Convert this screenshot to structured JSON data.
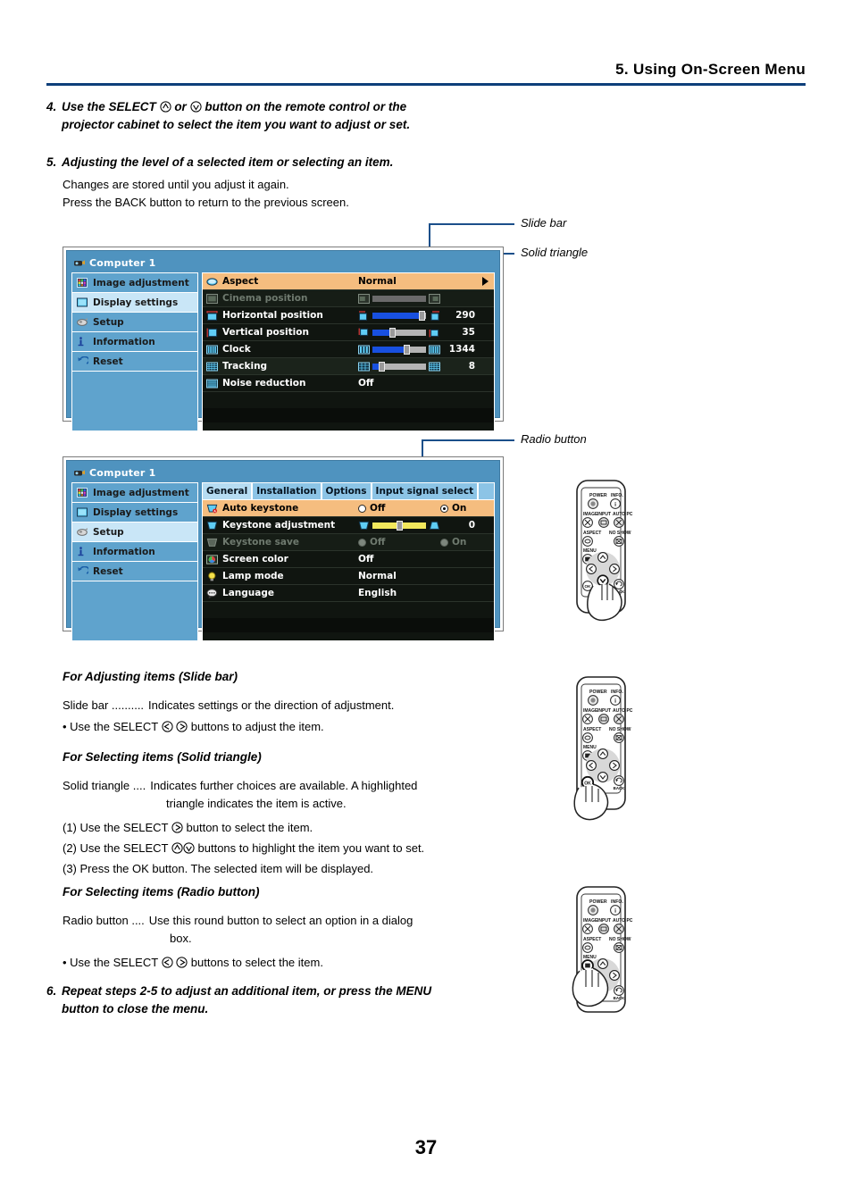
{
  "header": {
    "chapter_title": "5. Using On-Screen Menu"
  },
  "steps": [
    {
      "number": "4.",
      "text_before": "Use the SELECT",
      "icon_a": "select-up-icon",
      "text_mid": "or",
      "icon_b": "select-down-icon",
      "text_after": "button on the remote control or the",
      "line2": "projector cabinet to select the item you want to adjust or set."
    },
    {
      "number": "5.",
      "title": "Adjusting the level of a selected item or selecting an item.",
      "body_line1": "Changes are stored until you adjust it again.",
      "body_line2": "Press the BACK button to return to the previous screen."
    },
    {
      "number": "6.",
      "line1": "Repeat steps 2-5 to adjust an additional item, or press the MENU",
      "line2": "button to close the menu."
    }
  ],
  "callouts": {
    "slide_bar": "Slide bar",
    "solid_triangle": "Solid triangle",
    "radio_button": "Radio button"
  },
  "osd1": {
    "title": "Computer 1",
    "title_icon": "projector-icon",
    "nav": [
      {
        "label": "Image adjustment",
        "icon": "image-adjustment-icon",
        "selected": false
      },
      {
        "label": "Display settings",
        "icon": "display-settings-icon",
        "selected": true
      },
      {
        "label": "Setup",
        "icon": "setup-icon",
        "selected": false
      },
      {
        "label": "Information",
        "icon": "information-icon",
        "selected": false
      },
      {
        "label": "Reset",
        "icon": "reset-icon",
        "selected": false
      }
    ],
    "rows": [
      {
        "label": "Aspect",
        "icon": "aspect-icon",
        "value": "Normal",
        "state": "highlighted",
        "control": "triangle"
      },
      {
        "label": "Cinema position",
        "icon": "cinema-position-icon",
        "value": "",
        "state": "disabled",
        "control": "slider",
        "slider": {
          "fill_pct": 0,
          "knob_pct": 0,
          "color": "grey"
        },
        "number": ""
      },
      {
        "label": "Horizontal position",
        "icon": "horizontal-position-icon",
        "value": "",
        "state": "normal",
        "control": "slider",
        "slider": {
          "fill_pct": 90,
          "knob_pct": 90,
          "color": "blue"
        },
        "number": "290"
      },
      {
        "label": "Vertical position",
        "icon": "vertical-position-icon",
        "value": "",
        "state": "normal",
        "control": "slider",
        "slider": {
          "fill_pct": 33,
          "knob_pct": 33,
          "color": "blue"
        },
        "number": "35"
      },
      {
        "label": "Clock",
        "icon": "clock-icon",
        "value": "",
        "state": "normal",
        "control": "slider",
        "slider": {
          "fill_pct": 62,
          "knob_pct": 62,
          "color": "blue"
        },
        "number": "1344"
      },
      {
        "label": "Tracking",
        "icon": "tracking-icon",
        "value": "",
        "state": "normal",
        "control": "slider",
        "slider": {
          "fill_pct": 12,
          "knob_pct": 12,
          "color": "blue"
        },
        "number": "8"
      },
      {
        "label": "Noise reduction",
        "icon": "noise-reduction-icon",
        "value": "Off",
        "state": "normal",
        "control": "value",
        "number": ""
      }
    ]
  },
  "osd2": {
    "title": "Computer 1",
    "title_icon": "projector-icon",
    "nav": [
      {
        "label": "Image adjustment",
        "icon": "image-adjustment-icon",
        "selected": false
      },
      {
        "label": "Display settings",
        "icon": "display-settings-icon",
        "selected": false
      },
      {
        "label": "Setup",
        "icon": "setup-icon",
        "selected": true
      },
      {
        "label": "Information",
        "icon": "information-icon",
        "selected": false
      },
      {
        "label": "Reset",
        "icon": "reset-icon",
        "selected": false
      }
    ],
    "tabs": [
      {
        "label": "General",
        "selected": true
      },
      {
        "label": "Installation",
        "selected": false
      },
      {
        "label": "Options",
        "selected": false
      },
      {
        "label": "Input signal select",
        "selected": false
      }
    ],
    "rows": [
      {
        "label": "Auto keystone",
        "icon": "auto-keystone-icon",
        "state": "highlighted",
        "control": "radio",
        "options": [
          {
            "label": "Off",
            "checked": false
          },
          {
            "label": "On",
            "checked": true
          }
        ]
      },
      {
        "label": "Keystone adjustment",
        "icon": "keystone-adjustment-icon",
        "state": "normal",
        "control": "slider",
        "slider": {
          "fill_pct": 100,
          "knob_pct": 47,
          "color": "yellow"
        },
        "number": "0"
      },
      {
        "label": "Keystone save",
        "icon": "keystone-save-icon",
        "state": "disabled",
        "control": "radio",
        "options": [
          {
            "label": "Off",
            "checked": false
          },
          {
            "label": "On",
            "checked": false
          }
        ]
      },
      {
        "label": "Screen color",
        "icon": "screen-color-icon",
        "state": "normal",
        "control": "value",
        "value": "Off"
      },
      {
        "label": "Lamp mode",
        "icon": "lamp-mode-icon",
        "state": "normal",
        "control": "value",
        "value": "Normal"
      },
      {
        "label": "Language",
        "icon": "language-icon",
        "state": "normal",
        "control": "value",
        "value": "English"
      }
    ]
  },
  "sections": [
    {
      "heading": "For Adjusting items (Slide bar)",
      "term": "Slide bar ..........",
      "definition": "Indicates settings or the direction of adjustment.",
      "bullet_before": "• Use the SELECT",
      "bullet_after": "buttons to adjust the item."
    },
    {
      "heading": "For Selecting items (Solid triangle)",
      "term": "Solid triangle ....",
      "definition_line1": "Indicates further choices are available. A highlighted",
      "definition_line2": "triangle indicates the item is active.",
      "item1_before": "(1) Use the SELECT",
      "item1_after": "button to select the item.",
      "item2_before": "(2) Use the SELECT",
      "item2_after": "buttons to highlight the item you want to set.",
      "item3": "(3) Press the OK button. The selected item will be displayed."
    },
    {
      "heading": "For Selecting items (Radio button)",
      "term": "Radio button ....",
      "definition_line1": "Use this round button to select an option in a dialog",
      "definition_line2": "box.",
      "bullet_before": "• Use the SELECT",
      "bullet_after": "buttons to select the item."
    }
  ],
  "remotes": [
    {
      "name": "remote-select-down",
      "buttons": {
        "power": "POWER",
        "info": "INFO.",
        "image": "IMAGE",
        "input": "INPUT",
        "auto_pc": "AUTO PC",
        "aspect": "ASPECT",
        "no_show": "NO SHOW",
        "menu": "MENU",
        "ok": "OK",
        "back": "BACK"
      },
      "pressed": "select-down"
    },
    {
      "name": "remote-ok",
      "buttons": {
        "power": "POWER",
        "info": "INFO.",
        "image": "IMAGE",
        "input": "INPUT",
        "auto_pc": "AUTO PC",
        "aspect": "ASPECT",
        "no_show": "NO SHOW",
        "menu": "MENU",
        "ok": "OK",
        "back": "BACK"
      },
      "pressed": "ok"
    },
    {
      "name": "remote-menu",
      "buttons": {
        "power": "POWER",
        "info": "INFO.",
        "image": "IMAGE",
        "input": "INPUT",
        "auto_pc": "AUTO PC",
        "aspect": "ASPECT",
        "no_show": "NO SHOW",
        "menu": "MENU",
        "back": "BACK"
      },
      "pressed": "menu"
    }
  ],
  "footer": {
    "page_number": "37"
  },
  "colors": {
    "accent_blue": "#0d3f7a",
    "leader_blue": "#1b4f8a",
    "osd_frame": "#4f93bf",
    "osd_nav": "#5fa3cd",
    "osd_nav_selected": "#c9e6f7",
    "osd_highlight": "#f5bd7f",
    "slider_blue": "#1850e0",
    "slider_yellow": "#f2e85c"
  }
}
